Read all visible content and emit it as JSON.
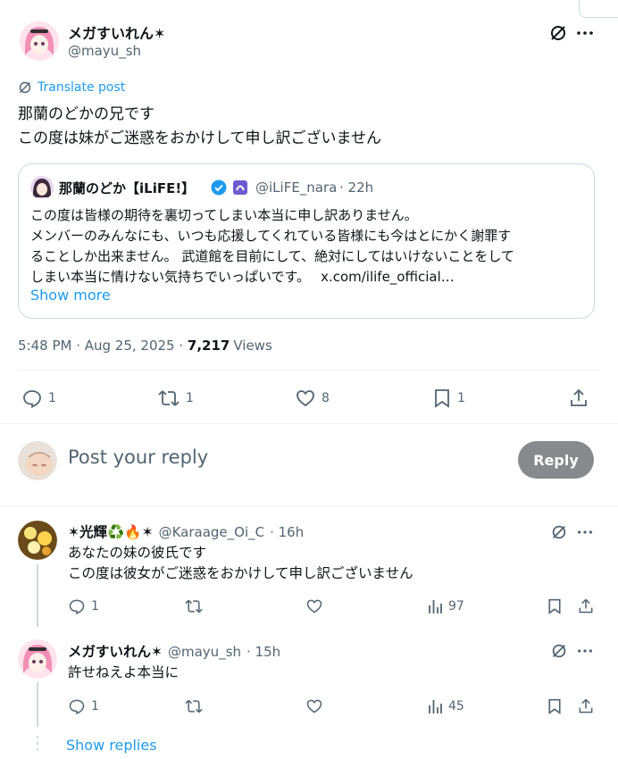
{
  "main_post": {
    "display_name": "メガすいれん✶",
    "handle": "@mayu_sh",
    "translate_label": "Translate post",
    "text_line1": "那蘭のどかの兄です",
    "text_line2": "この度は妹がご迷惑をおかけして申し訳ございません",
    "timestamp": "5:48 PM · Aug 25, 2025 · ",
    "views_count": "7,217",
    "views_label": "Views",
    "stats": {
      "replies": "1",
      "reposts": "1",
      "likes": "8",
      "bookmarks": "1"
    }
  },
  "quoted_post": {
    "display_name": "那蘭のどか【iLiFE!】",
    "handle": "@iLiFE_nara",
    "time": "· 22h",
    "lines": [
      "この度は皆様の期待を裏切ってしまい本当に申し訳ありません。",
      "メンバーのみんなにも、いつも応援してくれている皆様にも今はとにかく謝罪す",
      "ることしか出来ません。 武道館を目前にして、絶対にしてはいけないことをして",
      "しまい本当に情けない気持ちでいっぱいです。"
    ],
    "link": "x.com/ilife_official…",
    "show_more": "Show more"
  },
  "composer": {
    "placeholder": "Post your reply",
    "reply_button": "Reply"
  },
  "replies": [
    {
      "display_name": "✶光輝♻️🔥✶",
      "handle": "@Karaage_Oi_C",
      "time": "· 16h",
      "lines": [
        "あなたの妹の彼氏です",
        "この度は彼女がご迷惑をおかけして申し訳ございません"
      ],
      "stats": {
        "replies": "1",
        "reposts": "",
        "likes": "",
        "views": "97"
      }
    },
    {
      "display_name": "メガすいれん✶",
      "handle": "@mayu_sh",
      "time": "· 15h",
      "lines": [
        "許せねえよ本当に"
      ],
      "stats": {
        "replies": "1",
        "reposts": "",
        "likes": "",
        "views": "45"
      }
    }
  ],
  "show_replies": "Show replies",
  "colors": {
    "accent": "#1d9bf0",
    "muted": "#536471",
    "verified": "#1d9bf0",
    "reply_button_bg": "#87898c"
  }
}
